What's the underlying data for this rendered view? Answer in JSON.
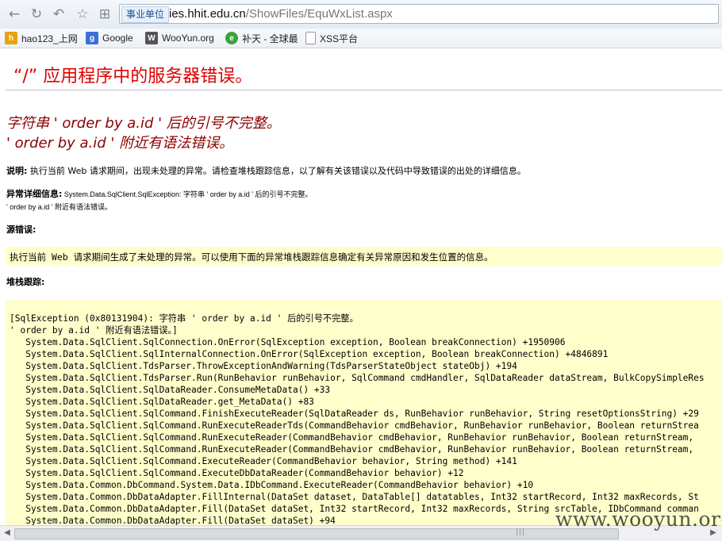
{
  "browser": {
    "address_badge": "事业单位",
    "url_host": "ies.hhit.edu.cn",
    "url_path": "/ShowFiles/EquWxList.aspx",
    "bookmarks": [
      {
        "label": "hao123_上网",
        "icon": "hao123-icon",
        "color": "#e8a20a"
      },
      {
        "label": "Google",
        "icon": "google-icon",
        "color": "#3b6fd6"
      },
      {
        "label": "WooYun.org",
        "icon": "wooyun-icon",
        "color": "#555555"
      },
      {
        "label": "补天 - 全球最",
        "icon": "butian-icon",
        "color": "#3aa43a"
      },
      {
        "label": "XSS平台",
        "icon": "page-icon",
        "color": "#999999"
      }
    ]
  },
  "error_page": {
    "title": "“/” 应用程序中的服务器错误。",
    "headline_1": "字符串 ' order by a.id ' 后的引号不完整。",
    "headline_2": "' order by a.id ' 附近有语法错误。",
    "description_label": "说明:",
    "description_text": " 执行当前 Web 请求期间，出现未处理的异常。请检查堆栈跟踪信息，以了解有关该错误以及代码中导致错误的出处的详细信息。",
    "exception_label": "异常详细信息:",
    "exception_text": " System.Data.SqlClient.SqlException: 字符串 ' order by a.id ' 后的引号不完整。",
    "exception_text_2": "' order by a.id ' 附近有语法错误。",
    "source_label": "源错误:",
    "source_text": "执行当前 Web 请求期间生成了未处理的异常。可以使用下面的异常堆栈跟踪信息确定有关异常原因和发生位置的信息。",
    "stack_label": "堆栈跟踪:",
    "stack_lines": [
      "[SqlException (0x80131904): 字符串 ' order by a.id ' 后的引号不完整。",
      "' order by a.id ' 附近有语法错误。]",
      "   System.Data.SqlClient.SqlConnection.OnError(SqlException exception, Boolean breakConnection) +1950906",
      "   System.Data.SqlClient.SqlInternalConnection.OnError(SqlException exception, Boolean breakConnection) +4846891",
      "   System.Data.SqlClient.TdsParser.ThrowExceptionAndWarning(TdsParserStateObject stateObj) +194",
      "   System.Data.SqlClient.TdsParser.Run(RunBehavior runBehavior, SqlCommand cmdHandler, SqlDataReader dataStream, BulkCopySimpleRes",
      "   System.Data.SqlClient.SqlDataReader.ConsumeMetaData() +33",
      "   System.Data.SqlClient.SqlDataReader.get_MetaData() +83",
      "   System.Data.SqlClient.SqlCommand.FinishExecuteReader(SqlDataReader ds, RunBehavior runBehavior, String resetOptionsString) +29",
      "   System.Data.SqlClient.SqlCommand.RunExecuteReaderTds(CommandBehavior cmdBehavior, RunBehavior runBehavior, Boolean returnStrea",
      "   System.Data.SqlClient.SqlCommand.RunExecuteReader(CommandBehavior cmdBehavior, RunBehavior runBehavior, Boolean returnStream,",
      "   System.Data.SqlClient.SqlCommand.RunExecuteReader(CommandBehavior cmdBehavior, RunBehavior runBehavior, Boolean returnStream,",
      "   System.Data.SqlClient.SqlCommand.ExecuteReader(CommandBehavior behavior, String method) +141",
      "   System.Data.SqlClient.SqlCommand.ExecuteDbDataReader(CommandBehavior behavior) +12",
      "   System.Data.Common.DbCommand.System.Data.IDbCommand.ExecuteReader(CommandBehavior behavior) +10",
      "   System.Data.Common.DbDataAdapter.FillInternal(DataSet dataset, DataTable[] datatables, Int32 startRecord, Int32 maxRecords, St",
      "   System.Data.Common.DbDataAdapter.Fill(DataSet dataSet, Int32 startRecord, Int32 maxRecords, String srcTable, IDbCommand comman",
      "   System.Data.Common.DbDataAdapter.Fill(DataSet dataSet) +94"
    ]
  },
  "watermark": "www.wooyun.org"
}
